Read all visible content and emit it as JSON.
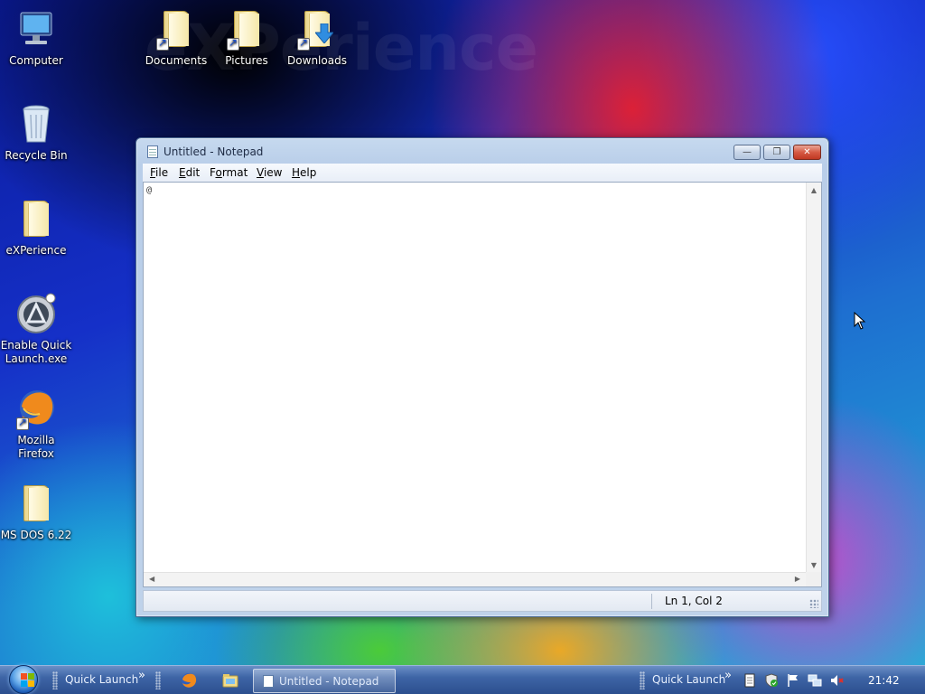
{
  "desktop": {
    "watermark": "eXPerience",
    "icons": [
      {
        "label": "Computer",
        "icon": "computer-icon"
      },
      {
        "label": "Recycle Bin",
        "icon": "recycle-bin-icon"
      },
      {
        "label": "eXPerience",
        "icon": "folder-icon"
      },
      {
        "label": "Enable Quick Launch.exe",
        "icon": "app-icon"
      },
      {
        "label": "Mozilla Firefox",
        "icon": "firefox-icon"
      },
      {
        "label": "MS DOS 6.22",
        "icon": "folder-icon"
      },
      {
        "label": "Documents",
        "icon": "folder-shortcut-icon"
      },
      {
        "label": "Pictures",
        "icon": "folder-shortcut-icon"
      },
      {
        "label": "Downloads",
        "icon": "downloads-folder-icon"
      }
    ]
  },
  "notepad": {
    "title": "Untitled - Notepad",
    "menu": [
      "File",
      "Edit",
      "Format",
      "View",
      "Help"
    ],
    "menu_access_keys": [
      "F",
      "E",
      "o",
      "V",
      "H"
    ],
    "content": "@",
    "status": "Ln 1, Col 2",
    "controls": {
      "minimize": "—",
      "maximize": "❐",
      "close": "✕"
    }
  },
  "taskbar": {
    "quick_launch_left": "Quick Launch",
    "chevron": "»",
    "active_task": "Untitled - Notepad",
    "quick_launch_right": "Quick Launch",
    "clock": "21:42"
  },
  "colors": {
    "taskbar": "#3e65a6",
    "close_button": "#d65a44",
    "window_frame": "#bfd2ea"
  }
}
